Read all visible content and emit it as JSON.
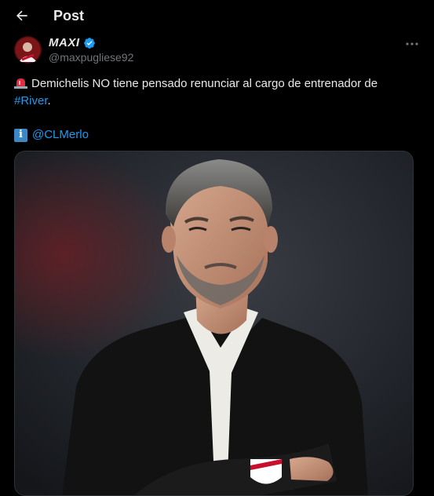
{
  "header": {
    "title": "Post",
    "back_icon": "arrow-left-icon"
  },
  "author": {
    "display_name": "MAXI",
    "handle": "@maxpugliese92",
    "verified": true,
    "verified_color": "#1d9bf0",
    "more_icon": "more-horizontal-icon"
  },
  "tweet": {
    "emoji": "rotating-light-icon",
    "text_before": "Demichelis NO tiene pensado renunciar al cargo de entrenador de ",
    "hashtag": "#River",
    "text_after": ".",
    "info_emoji": "i",
    "mention": "@CLMerlo"
  },
  "colors": {
    "background": "#000000",
    "text": "#e7e9ea",
    "secondary": "#71767b",
    "accent": "#1d9bf0"
  }
}
